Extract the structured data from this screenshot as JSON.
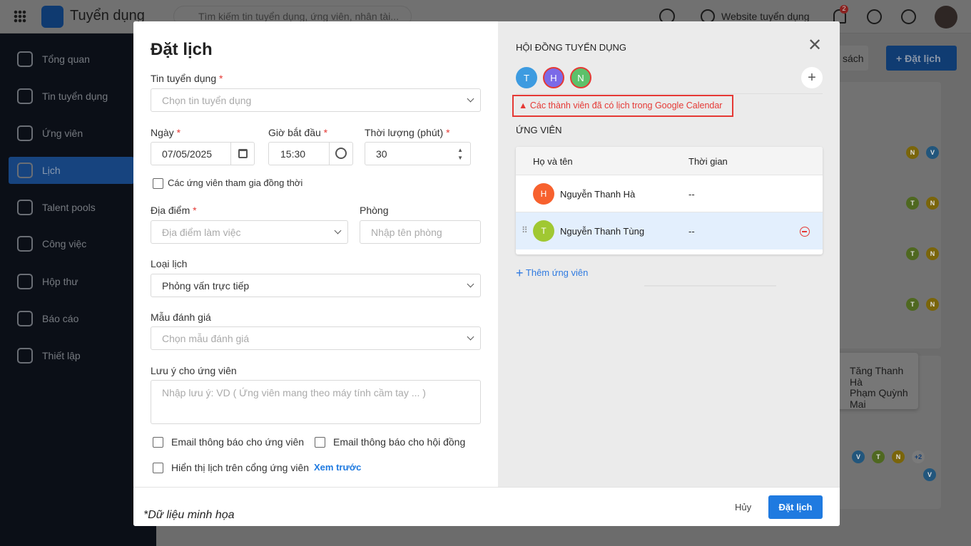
{
  "app": {
    "title": "Tuyển dụng",
    "search_placeholder": "Tìm kiếm tin tuyển dụng, ứng viên, nhân tài...",
    "website_label": "Website tuyển dụng",
    "notification_count": "2"
  },
  "sidebar": {
    "items": [
      {
        "label": "Tổng quan"
      },
      {
        "label": "Tin tuyển dụng"
      },
      {
        "label": "Ứng viên"
      },
      {
        "label": "Lịch",
        "active": true
      },
      {
        "label": "Talent pools"
      },
      {
        "label": "Công việc"
      },
      {
        "label": "Hộp thư"
      },
      {
        "label": "Báo cáo"
      },
      {
        "label": "Thiết lập"
      }
    ]
  },
  "background": {
    "list_button": "sách",
    "schedule_button": "Đặt lịch",
    "names": [
      "Tăng Thanh Hà",
      "Phạm Quỳnh Mai"
    ],
    "more_count": "+2"
  },
  "modal": {
    "title": "Đặt lịch",
    "job": {
      "label": "Tin tuyển dụng",
      "placeholder": "Chọn tin tuyển dụng"
    },
    "date": {
      "label": "Ngày",
      "value": "07/05/2025"
    },
    "start_time": {
      "label": "Giờ bắt đầu",
      "value": "15:30"
    },
    "duration": {
      "label": "Thời lượng (phút)",
      "value": "30"
    },
    "simultaneous": {
      "label": "Các ứng viên tham gia đồng thời",
      "checked": false
    },
    "location": {
      "label": "Địa điểm",
      "placeholder": "Địa điểm làm việc"
    },
    "room": {
      "label": "Phòng",
      "placeholder": "Nhập tên phòng"
    },
    "type": {
      "label": "Loại lịch",
      "value": "Phỏng vấn trực tiếp"
    },
    "template": {
      "label": "Mẫu đánh giá",
      "placeholder": "Chọn mẫu đánh giá"
    },
    "note": {
      "label": "Lưu ý cho ứng viên",
      "placeholder": "Nhập lưu ý: VD ( Ứng viên mang theo máy tính cầm tay ... )"
    },
    "email_candidate": "Email thông báo cho ứng viên",
    "email_council": "Email thông báo cho hội đồng",
    "show_portal": "Hiển thị lịch trên cổng ứng viên",
    "preview": "Xem trước",
    "council": {
      "title": "HỘI ĐỒNG TUYỂN DỤNG",
      "members": [
        {
          "initial": "T",
          "color": "#3d9be0"
        },
        {
          "initial": "H",
          "color": "#7b6ae8"
        },
        {
          "initial": "N",
          "color": "#5cc16a"
        }
      ],
      "warning": "Các thành viên đã có lịch trong Google Calendar"
    },
    "candidates": {
      "title": "ỨNG VIÊN",
      "columns": [
        "Họ và tên",
        "Thời gian"
      ],
      "rows": [
        {
          "initial": "H",
          "color": "#f7612e",
          "name": "Nguyễn Thanh Hà",
          "time": "--"
        },
        {
          "initial": "T",
          "color": "#a0c832",
          "name": "Nguyễn Thanh Tùng",
          "time": "--"
        }
      ],
      "add_label": "Thêm ứng viên"
    },
    "cancel": "Hủy",
    "submit": "Đặt lịch",
    "note_footer": "*Dữ liệu minh họa"
  }
}
